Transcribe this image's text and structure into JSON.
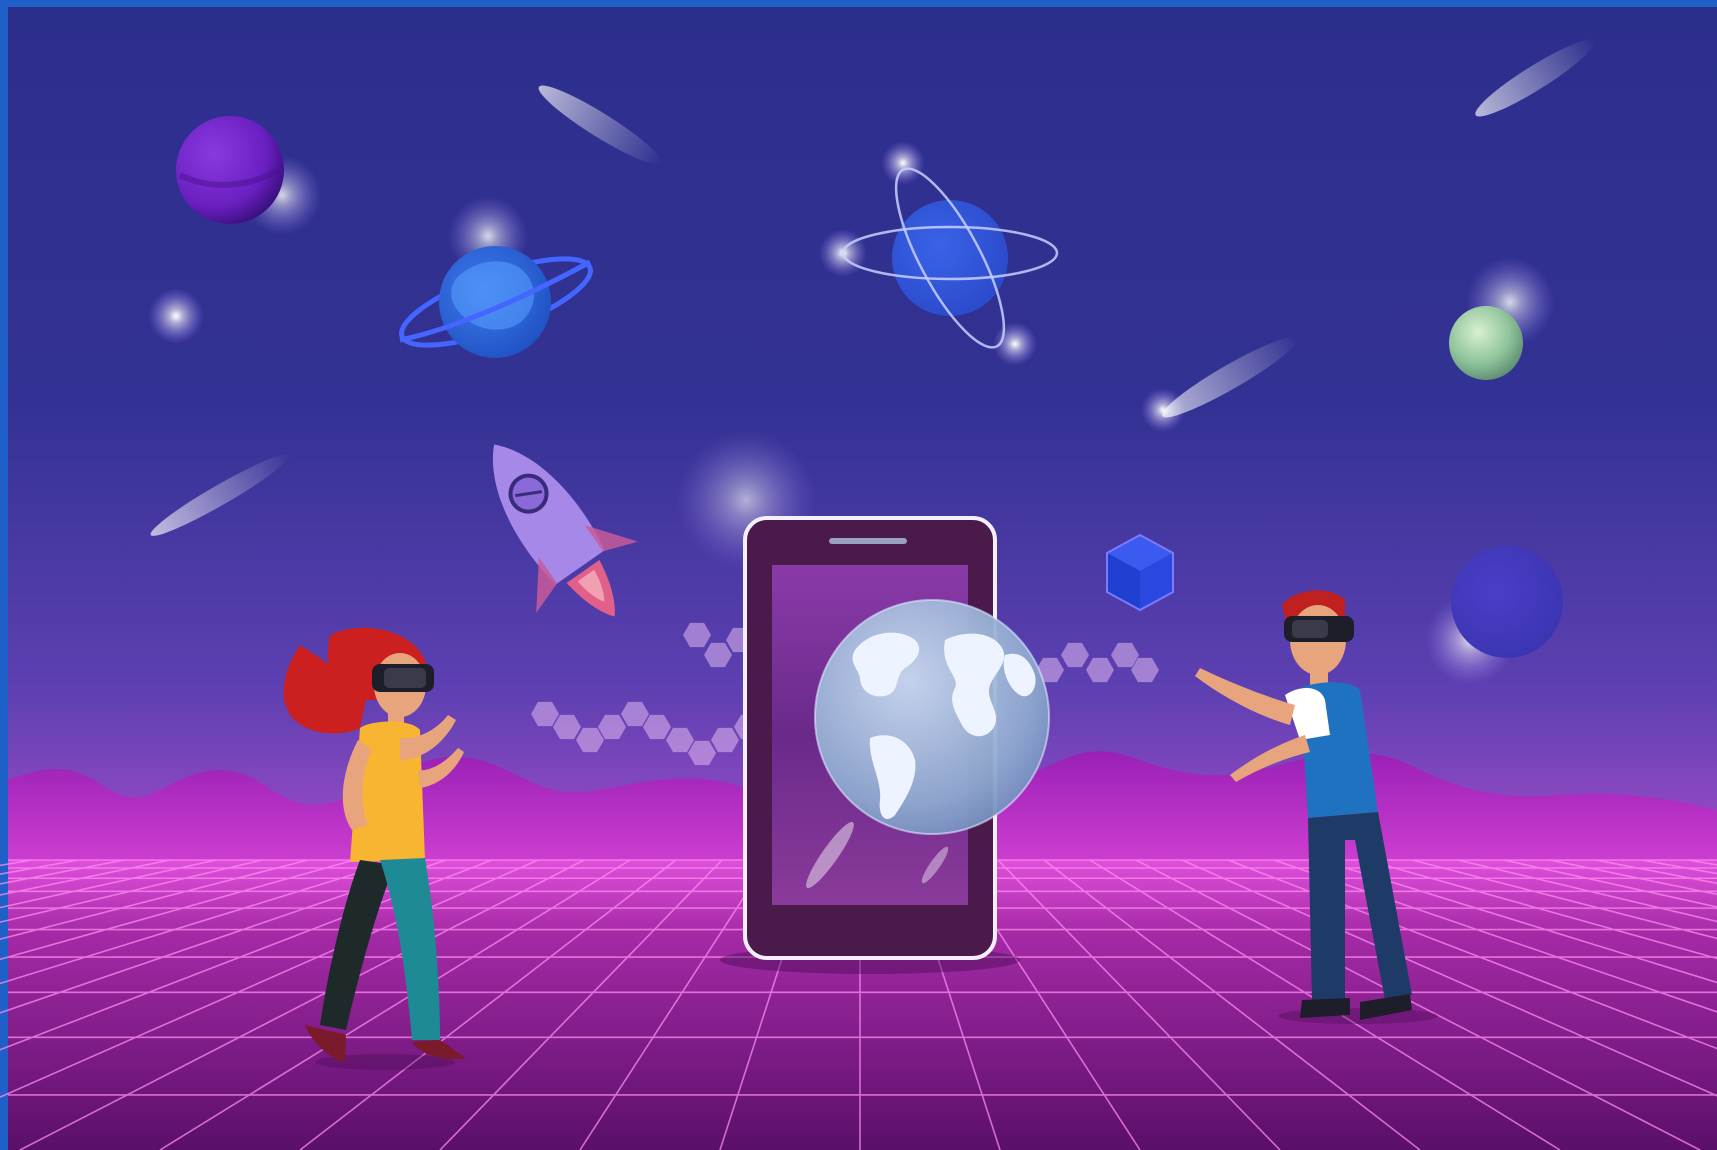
{
  "scene": {
    "subject": "metaverse-vr-illustration",
    "colors": {
      "frame": "#1f5fc8",
      "sky_top": "#2c2f8e",
      "sky_mid": "#5a3fb0",
      "horizon": "#b24ad0",
      "mountains": "#9a1fb8",
      "floor_top": "#d245d6",
      "floor_bottom": "#5a0f6e",
      "grid_line": "#ff7df0",
      "phone_body": "#4a1a4a",
      "phone_frame": "#f4f0ff",
      "globe_ocean": "#9db6d8",
      "globe_land": "#eef4ff",
      "planet_purple": "#6a1fc0",
      "planet_blue": "#2a6ad8",
      "planet_ring": "#3b5cff",
      "planet_green": "#8fc49a",
      "rocket_body": "#a688e8",
      "rocket_fin": "#c85a9a",
      "cube": "#1f3fd0",
      "woman_hair": "#cc2020",
      "woman_top": "#f7b531",
      "woman_pants": "#1e8a96",
      "man_hair": "#c02020",
      "man_vest": "#1f72c0",
      "man_jeans": "#1e3a66",
      "skin": "#e8a47c",
      "headset": "#1e1e2a"
    },
    "elements": [
      "phone-icon",
      "globe-icon",
      "rocket-icon",
      "ringed-planet-icon",
      "atom-planet-icon",
      "purple-planet-icon",
      "green-planet-icon",
      "blue-planet-icon",
      "cube-icon",
      "comet-icon",
      "woman-vr-figure",
      "man-vr-figure"
    ]
  }
}
